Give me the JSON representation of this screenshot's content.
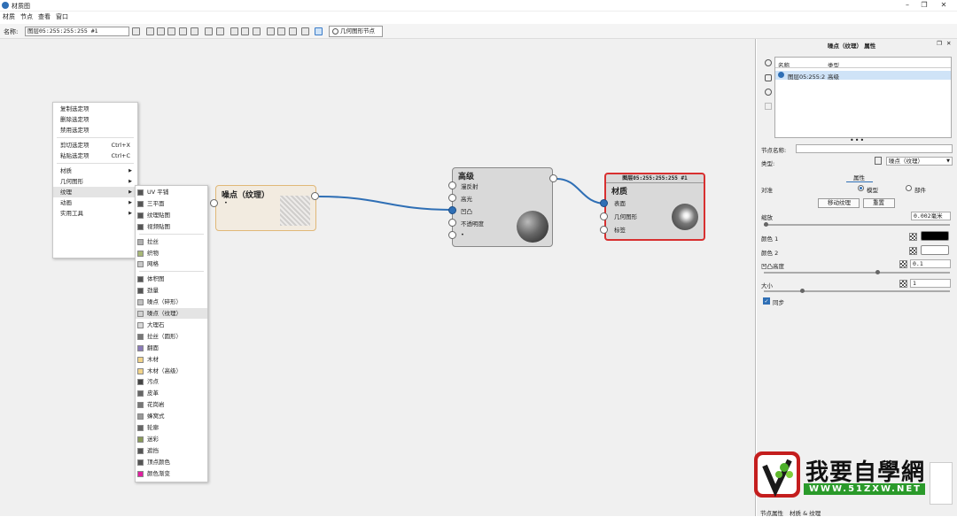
{
  "window": {
    "title": "材质图"
  },
  "menubar": [
    "材质",
    "节点",
    "查看",
    "窗口"
  ],
  "toolbar": {
    "name_label": "名称:",
    "name_value": "图层05:255:255:255 #1",
    "geometry_button": "几何图形节点"
  },
  "context_menu": {
    "items": [
      {
        "label": "复制选定项",
        "shortcut": ""
      },
      {
        "label": "删除选定项",
        "shortcut": ""
      },
      {
        "label": "禁用选定项",
        "shortcut": ""
      },
      {
        "label": "剪切选定项",
        "shortcut": "Ctrl+X"
      },
      {
        "label": "粘贴选定项",
        "shortcut": "Ctrl+C"
      },
      {
        "label": "材质",
        "shortcut": ""
      },
      {
        "label": "几何图形",
        "shortcut": ""
      },
      {
        "label": "纹理",
        "shortcut": ""
      },
      {
        "label": "动画",
        "shortcut": ""
      },
      {
        "label": "实用工具",
        "shortcut": ""
      }
    ]
  },
  "texture_submenu": {
    "items": [
      {
        "label": "UV 平铺",
        "color": "#555555"
      },
      {
        "label": "三平面",
        "color": "#555555"
      },
      {
        "label": "纹理贴图",
        "color": "#555555"
      },
      {
        "label": "视频贴图",
        "color": "#555555"
      },
      {
        "label": "拉丝",
        "color": "#b0b0b0"
      },
      {
        "label": "织物",
        "color": "#a8b878"
      },
      {
        "label": "网格",
        "color": "#c8c8c8"
      },
      {
        "label": "体积图",
        "color": "#555555"
      },
      {
        "label": "劲量",
        "color": "#555555"
      },
      {
        "label": "噪点（碎形）",
        "color": "#c0c0c0"
      },
      {
        "label": "噪点（纹理）",
        "color": "#d0d0d0"
      },
      {
        "label": "大理石",
        "color": "#d8d8d8"
      },
      {
        "label": "拉丝（圆形）",
        "color": "#777777"
      },
      {
        "label": "翻面",
        "color": "#8a7ab8"
      },
      {
        "label": "木材",
        "color": "#f2d48a"
      },
      {
        "label": "木材（高级）",
        "color": "#f2d48a"
      },
      {
        "label": "污点",
        "color": "#444444"
      },
      {
        "label": "皮革",
        "color": "#666666"
      },
      {
        "label": "花岗岩",
        "color": "#777777"
      },
      {
        "label": "蜂窝式",
        "color": "#999999"
      },
      {
        "label": "轮廓",
        "color": "#666666"
      },
      {
        "label": "迷彩",
        "color": "#8a9a5a"
      },
      {
        "label": "遮挡",
        "color": "#555555"
      },
      {
        "label": "顶点颜色",
        "color": "#555555"
      },
      {
        "label": "颜色渐变",
        "color": "#e020a0"
      }
    ]
  },
  "nodes": {
    "noise": {
      "title": "噪点（纹理）",
      "port": "•"
    },
    "advanced": {
      "title": "高级",
      "ports": [
        "漫反射",
        "高光",
        "凹凸",
        "不透明度",
        "•"
      ]
    },
    "material": {
      "header": "图层05:255:255:255 #1",
      "title": "材质",
      "ports": [
        "表面",
        "几何图形",
        "标签"
      ]
    }
  },
  "panel": {
    "title": "噪点（纹理） 属性",
    "list_headers": [
      "名称",
      "类型"
    ],
    "list_row": {
      "name": "图层05:255:2",
      "type": "高级"
    },
    "node_name_label": "节点名称:",
    "type_label": "类型:",
    "type_value": "噪点（纹理）",
    "props_tab": "属性",
    "target_label": "对准",
    "target_model": "模型",
    "target_part": "部件",
    "move_texture": "移动纹理",
    "reset": "重置",
    "scale_label": "缩放",
    "scale_value": "0.002毫米",
    "color1_label": "颜色 1",
    "color2_label": "颜色 2",
    "color1": "#000000",
    "color2": "#ffffff",
    "bump_label": "凹凸高度",
    "bump_value": "0.1",
    "size_label": "大小",
    "size_value": "1",
    "sync_label": "同步",
    "status_left": "节点属性",
    "status_right": "材质 & 纹理"
  },
  "watermark": {
    "brand": "我要自學網",
    "url": "WWW.51ZXW.NET"
  }
}
